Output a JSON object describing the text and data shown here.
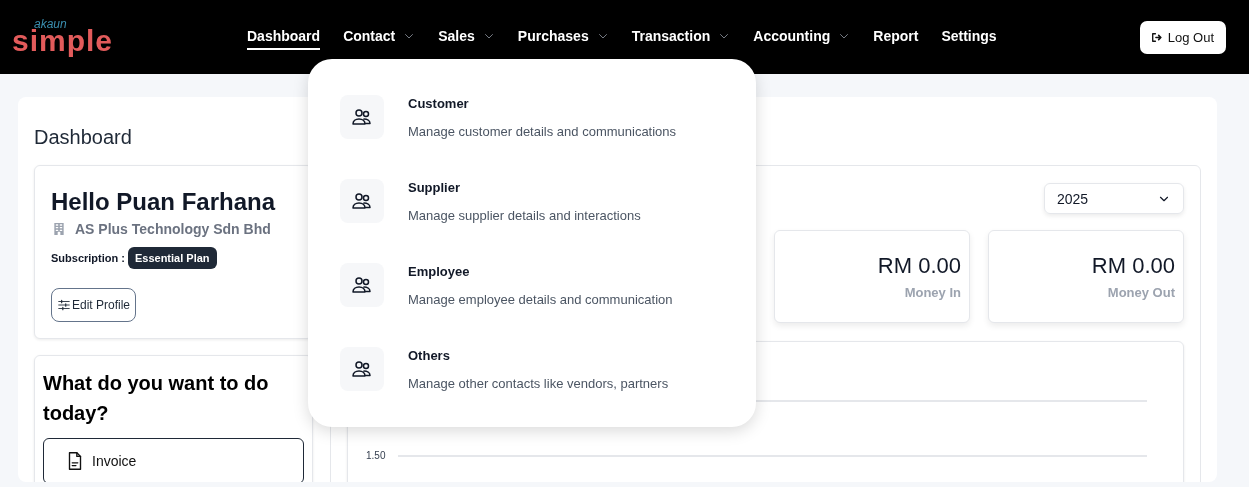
{
  "header": {
    "logo": {
      "small": "akaun",
      "large": "simple"
    },
    "nav": [
      {
        "label": "Dashboard",
        "selected": true,
        "has_menu": false
      },
      {
        "label": "Contact",
        "selected": false,
        "has_menu": true
      },
      {
        "label": "Sales",
        "selected": false,
        "has_menu": true
      },
      {
        "label": "Purchases",
        "selected": false,
        "has_menu": true
      },
      {
        "label": "Transaction",
        "selected": false,
        "has_menu": true
      },
      {
        "label": "Accounting",
        "selected": false,
        "has_menu": true
      },
      {
        "label": "Report",
        "selected": false,
        "has_menu": false
      },
      {
        "label": "Settings",
        "selected": false,
        "has_menu": false
      }
    ],
    "logout": "Log Out"
  },
  "page_title": "Dashboard",
  "profile": {
    "greeting": "Hello Puan Farhana",
    "company": "AS Plus Technology Sdn Bhd",
    "subscription_label": "Subscription :",
    "plan": "Essential Plan",
    "edit_button": "Edit Profile"
  },
  "quick_actions": {
    "title": "What do you want to do today?",
    "items": [
      "Invoice"
    ]
  },
  "year_select": {
    "value": "2025"
  },
  "stats": [
    {
      "amount": "RM 0.00",
      "label": "Money In"
    },
    {
      "amount": "RM 0.00",
      "label": "Money Out"
    }
  ],
  "chart": {
    "tick_labels": [
      "1.50"
    ]
  },
  "contact_menu": [
    {
      "title": "Customer",
      "description": "Manage customer details and communications"
    },
    {
      "title": "Supplier",
      "description": "Manage supplier details and interactions"
    },
    {
      "title": "Employee",
      "description": "Manage employee details and communication"
    },
    {
      "title": "Others",
      "description": "Manage other contacts like vendors, partners"
    }
  ]
}
